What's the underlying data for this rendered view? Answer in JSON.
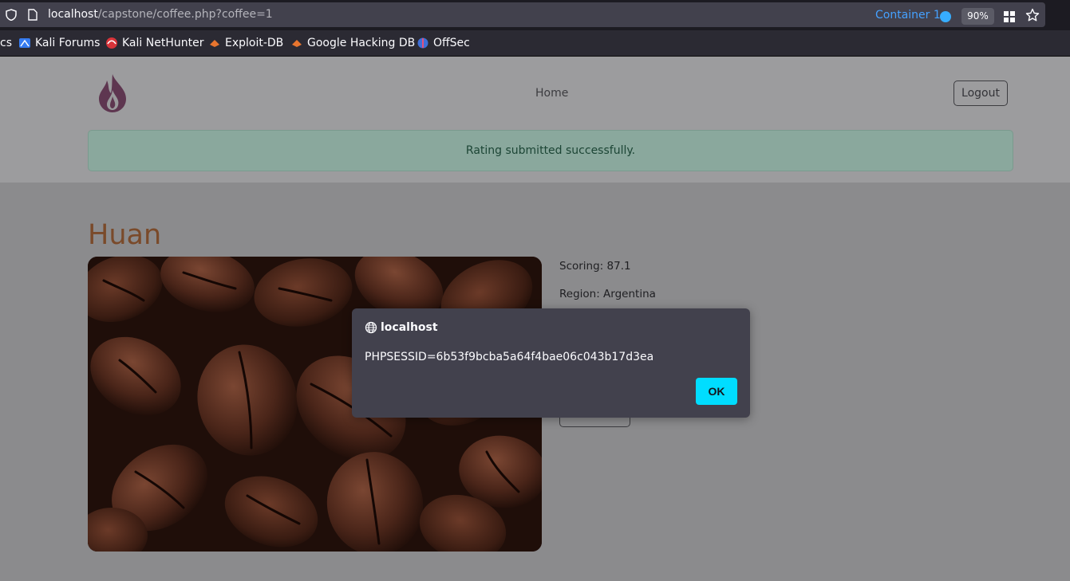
{
  "browser": {
    "url_host": "localhost",
    "url_path": "/capstone/coffee.php?coffee=1",
    "container_label": "Container 1",
    "zoom": "90%",
    "accent_color": "#00ddff",
    "bookmarks": [
      {
        "label": "cs",
        "icon": "none"
      },
      {
        "label": "Kali Forums",
        "icon": "kali-forums-icon"
      },
      {
        "label": "Kali NetHunter",
        "icon": "kali-nethunter-icon"
      },
      {
        "label": "Exploit-DB",
        "icon": "exploit-db-icon"
      },
      {
        "label": "Google Hacking DB",
        "icon": "ghdb-icon"
      },
      {
        "label": "OffSec",
        "icon": "offsec-icon"
      }
    ]
  },
  "site": {
    "nav_home": "Home",
    "logout_label": "Logout",
    "alert_text": "Rating submitted successfully.",
    "alert_color": "#8aa89d"
  },
  "coffee": {
    "name": "Huan",
    "scoring": "Scoring: 87.1",
    "region": "Region: Argentina"
  },
  "dialog": {
    "title": "localhost",
    "message": "PHPSESSID=6b53f9bcba5a64f4bae06c043b17d3ea",
    "ok_label": "OK"
  }
}
